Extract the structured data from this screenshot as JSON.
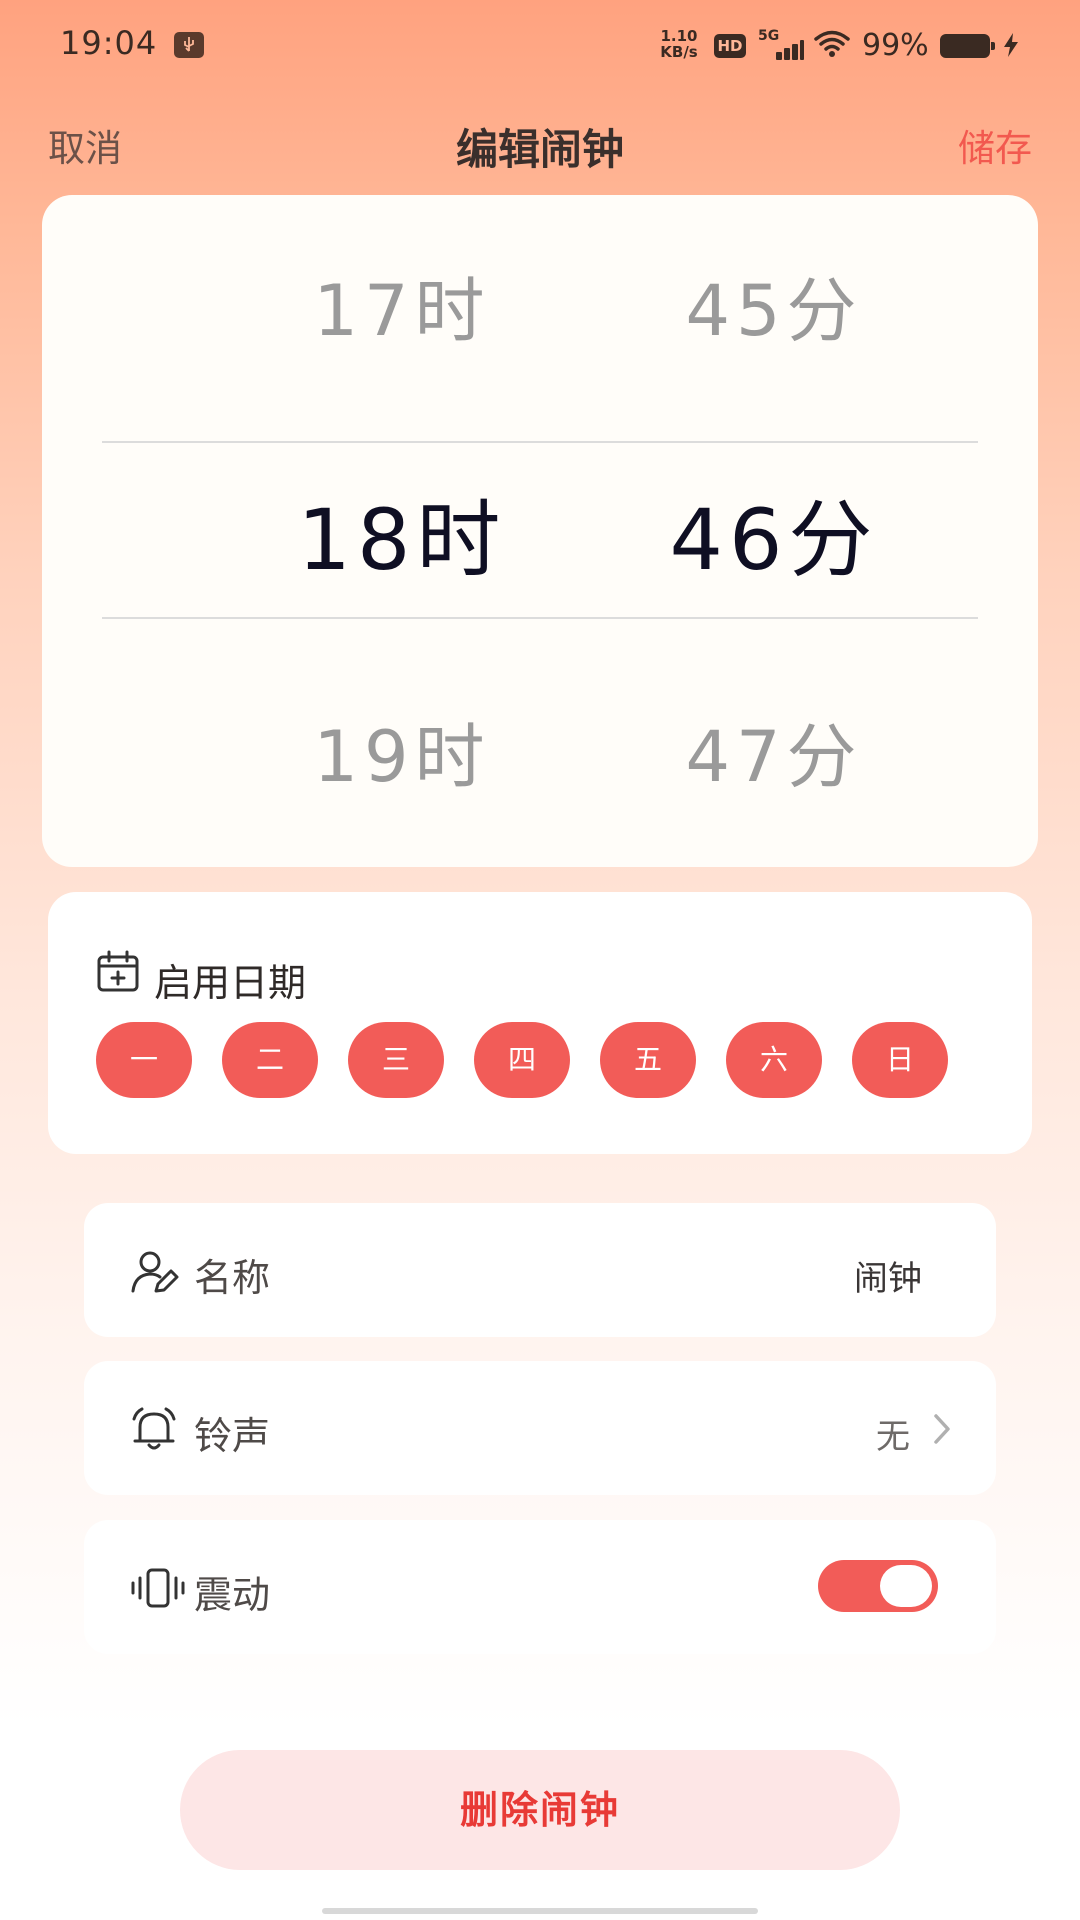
{
  "status_bar": {
    "time": "19:04",
    "net_speed_value": "1.10",
    "net_speed_unit": "KB/s",
    "hd_label": "HD",
    "signal_label": "5G",
    "battery_percent": "99%",
    "battery_level": 0.99,
    "usb_icon": "usb-debug-icon",
    "wifi_icon": "wifi-icon",
    "charging_icon": "bolt-icon"
  },
  "header": {
    "cancel_label": "取消",
    "title": "编辑闹钟",
    "save_label": "储存",
    "save_color": "#f2594f"
  },
  "time_picker": {
    "hours": {
      "prev": "17时",
      "selected": "18时",
      "next": "19时"
    },
    "minutes": {
      "prev": "45分",
      "selected": "46分",
      "next": "47分"
    },
    "selected_color": "#0f0f23",
    "dim_color": "#9a9a9a"
  },
  "repeat_days": {
    "title": "启用日期",
    "icon": "calendar-plus-icon",
    "days": [
      "一",
      "二",
      "三",
      "四",
      "五",
      "六",
      "日"
    ],
    "selected_color": "#f25c58"
  },
  "settings": {
    "name": {
      "label": "名称",
      "value": "闹钟",
      "icon": "user-edit-icon"
    },
    "ringtone": {
      "label": "铃声",
      "value": "无",
      "icon": "alarm-bell-icon"
    },
    "vibration": {
      "label": "震动",
      "enabled": true,
      "icon": "vibrate-icon",
      "toggle_color": "#f25c58"
    }
  },
  "delete_button": {
    "label": "删除闹钟",
    "text_color": "#e83a36",
    "background": "#fde6e6"
  }
}
